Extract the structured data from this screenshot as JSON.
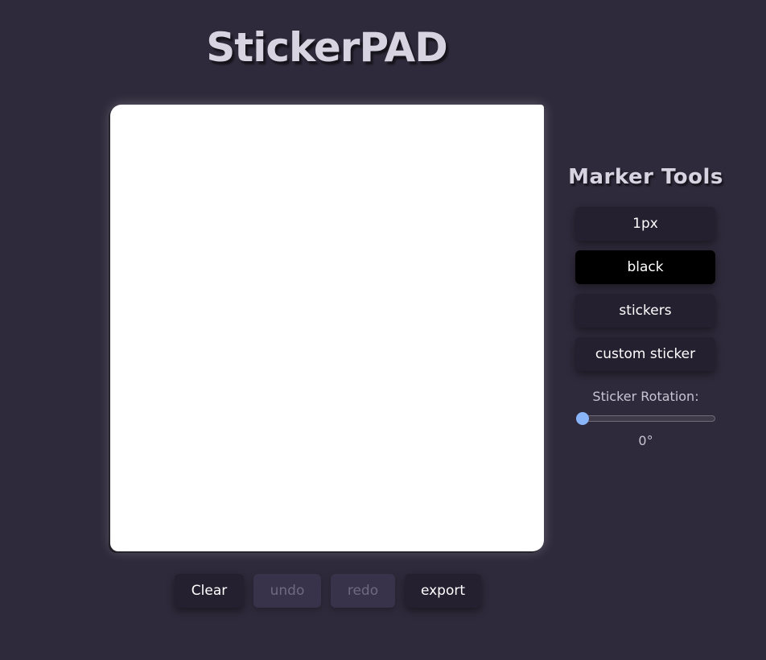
{
  "app": {
    "title": "StickerPAD"
  },
  "canvas": {
    "background": "#ffffff"
  },
  "bottom_bar": {
    "clear_label": "Clear",
    "undo_label": "undo",
    "redo_label": "redo",
    "export_label": "export"
  },
  "tools": {
    "title": "Marker Tools",
    "thickness_label": "1px",
    "color_label": "black",
    "stickers_label": "stickers",
    "custom_sticker_label": "custom sticker",
    "rotation_label": "Sticker Rotation:",
    "rotation_value": "0°",
    "rotation_fraction": 0
  },
  "colors": {
    "background": "#2f2a3b",
    "button": "#252030",
    "button_disabled": "#38324a",
    "selected_color": "#000000",
    "slider_thumb": "#8ab4f8"
  }
}
